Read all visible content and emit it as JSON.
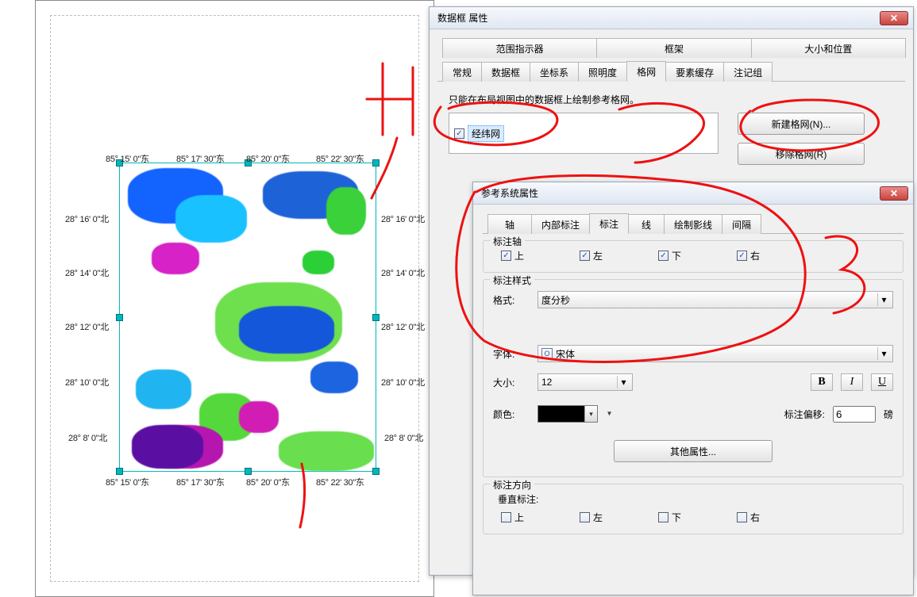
{
  "map": {
    "lon_labels": [
      "85° 15' 0\"东",
      "85° 17' 30\"东",
      "85° 20' 0\"东",
      "85° 22' 30\"东"
    ],
    "lat_labels": [
      "28° 16' 0\"北",
      "28° 14' 0\"北",
      "28° 12' 0\"北",
      "28° 10' 0\"北",
      "28° 8' 0\"北"
    ]
  },
  "dlg1": {
    "title": "数据框 属性",
    "tabs_row1": [
      "范围指示器",
      "框架",
      "大小和位置"
    ],
    "tabs_row2": [
      "常规",
      "数据框",
      "坐标系",
      "照明度",
      "格网",
      "要素缓存",
      "注记组"
    ],
    "hint": "只能在布局视图中的数据框上绘制参考格网。",
    "grid_item": "经纬网",
    "btn_new": "新建格网(N)...",
    "btn_remove": "移除格网(R)"
  },
  "dlg2": {
    "title": "参考系统属性",
    "tabs": [
      "轴",
      "内部标注",
      "标注",
      "线",
      "绘制影线",
      "间隔"
    ],
    "grp_axis": {
      "legend": "标注轴",
      "opts": [
        "上",
        "左",
        "下",
        "右"
      ]
    },
    "grp_style": {
      "legend": "标注样式",
      "format_lbl": "格式:",
      "format_val": "度分秒",
      "font_lbl": "字体:",
      "font_val": "宋体",
      "size_lbl": "大小:",
      "size_val": "12",
      "bold": "B",
      "italic": "I",
      "underline": "U",
      "color_lbl": "颜色:",
      "offset_lbl": "标注偏移:",
      "offset_val": "6",
      "offset_unit": "磅",
      "btn_more": "其他属性..."
    },
    "grp_orient": {
      "legend": "标注方向",
      "sub": "垂直标注:",
      "opts": [
        "上",
        "左",
        "下",
        "右"
      ]
    }
  }
}
